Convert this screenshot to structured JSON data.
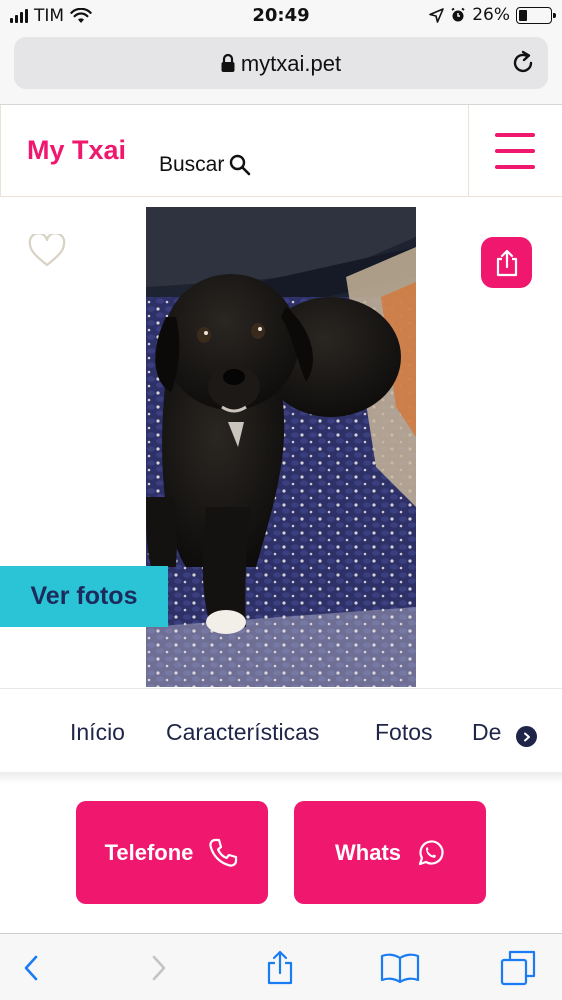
{
  "status_bar": {
    "carrier": "TIM",
    "time": "20:49",
    "battery_percent": "26%",
    "battery_level": 0.26,
    "icons": [
      "signal-icon",
      "wifi-icon",
      "location-arrow-icon",
      "alarm-icon",
      "battery-icon"
    ]
  },
  "browser": {
    "url": "mytxai.pet",
    "icons": [
      "lock-icon",
      "reload-icon"
    ]
  },
  "header": {
    "logo": "My Txai",
    "search_label": "Buscar",
    "icons": [
      "search-icon",
      "hamburger-menu-icon"
    ]
  },
  "pet_view": {
    "favorite_icon": "heart-icon",
    "share_icon": "share-icon",
    "photo_button": "Ver fotos"
  },
  "tabs": {
    "items": [
      "Início",
      "Características",
      "Fotos",
      "De"
    ],
    "next_icon": "chevron-right-icon"
  },
  "contact": {
    "phone_label": "Telefone",
    "whats_label": "Whats",
    "icons": [
      "phone-icon",
      "whatsapp-icon"
    ]
  },
  "toolbar": {
    "icons": [
      "back-icon",
      "forward-icon",
      "share-icon",
      "bookmarks-icon",
      "tabs-icon"
    ]
  },
  "colors": {
    "brand_pink": "#f0186e",
    "accent_cyan": "#2bc4d6",
    "navy": "#1f2548",
    "ios_blue": "#1a7cf5"
  }
}
